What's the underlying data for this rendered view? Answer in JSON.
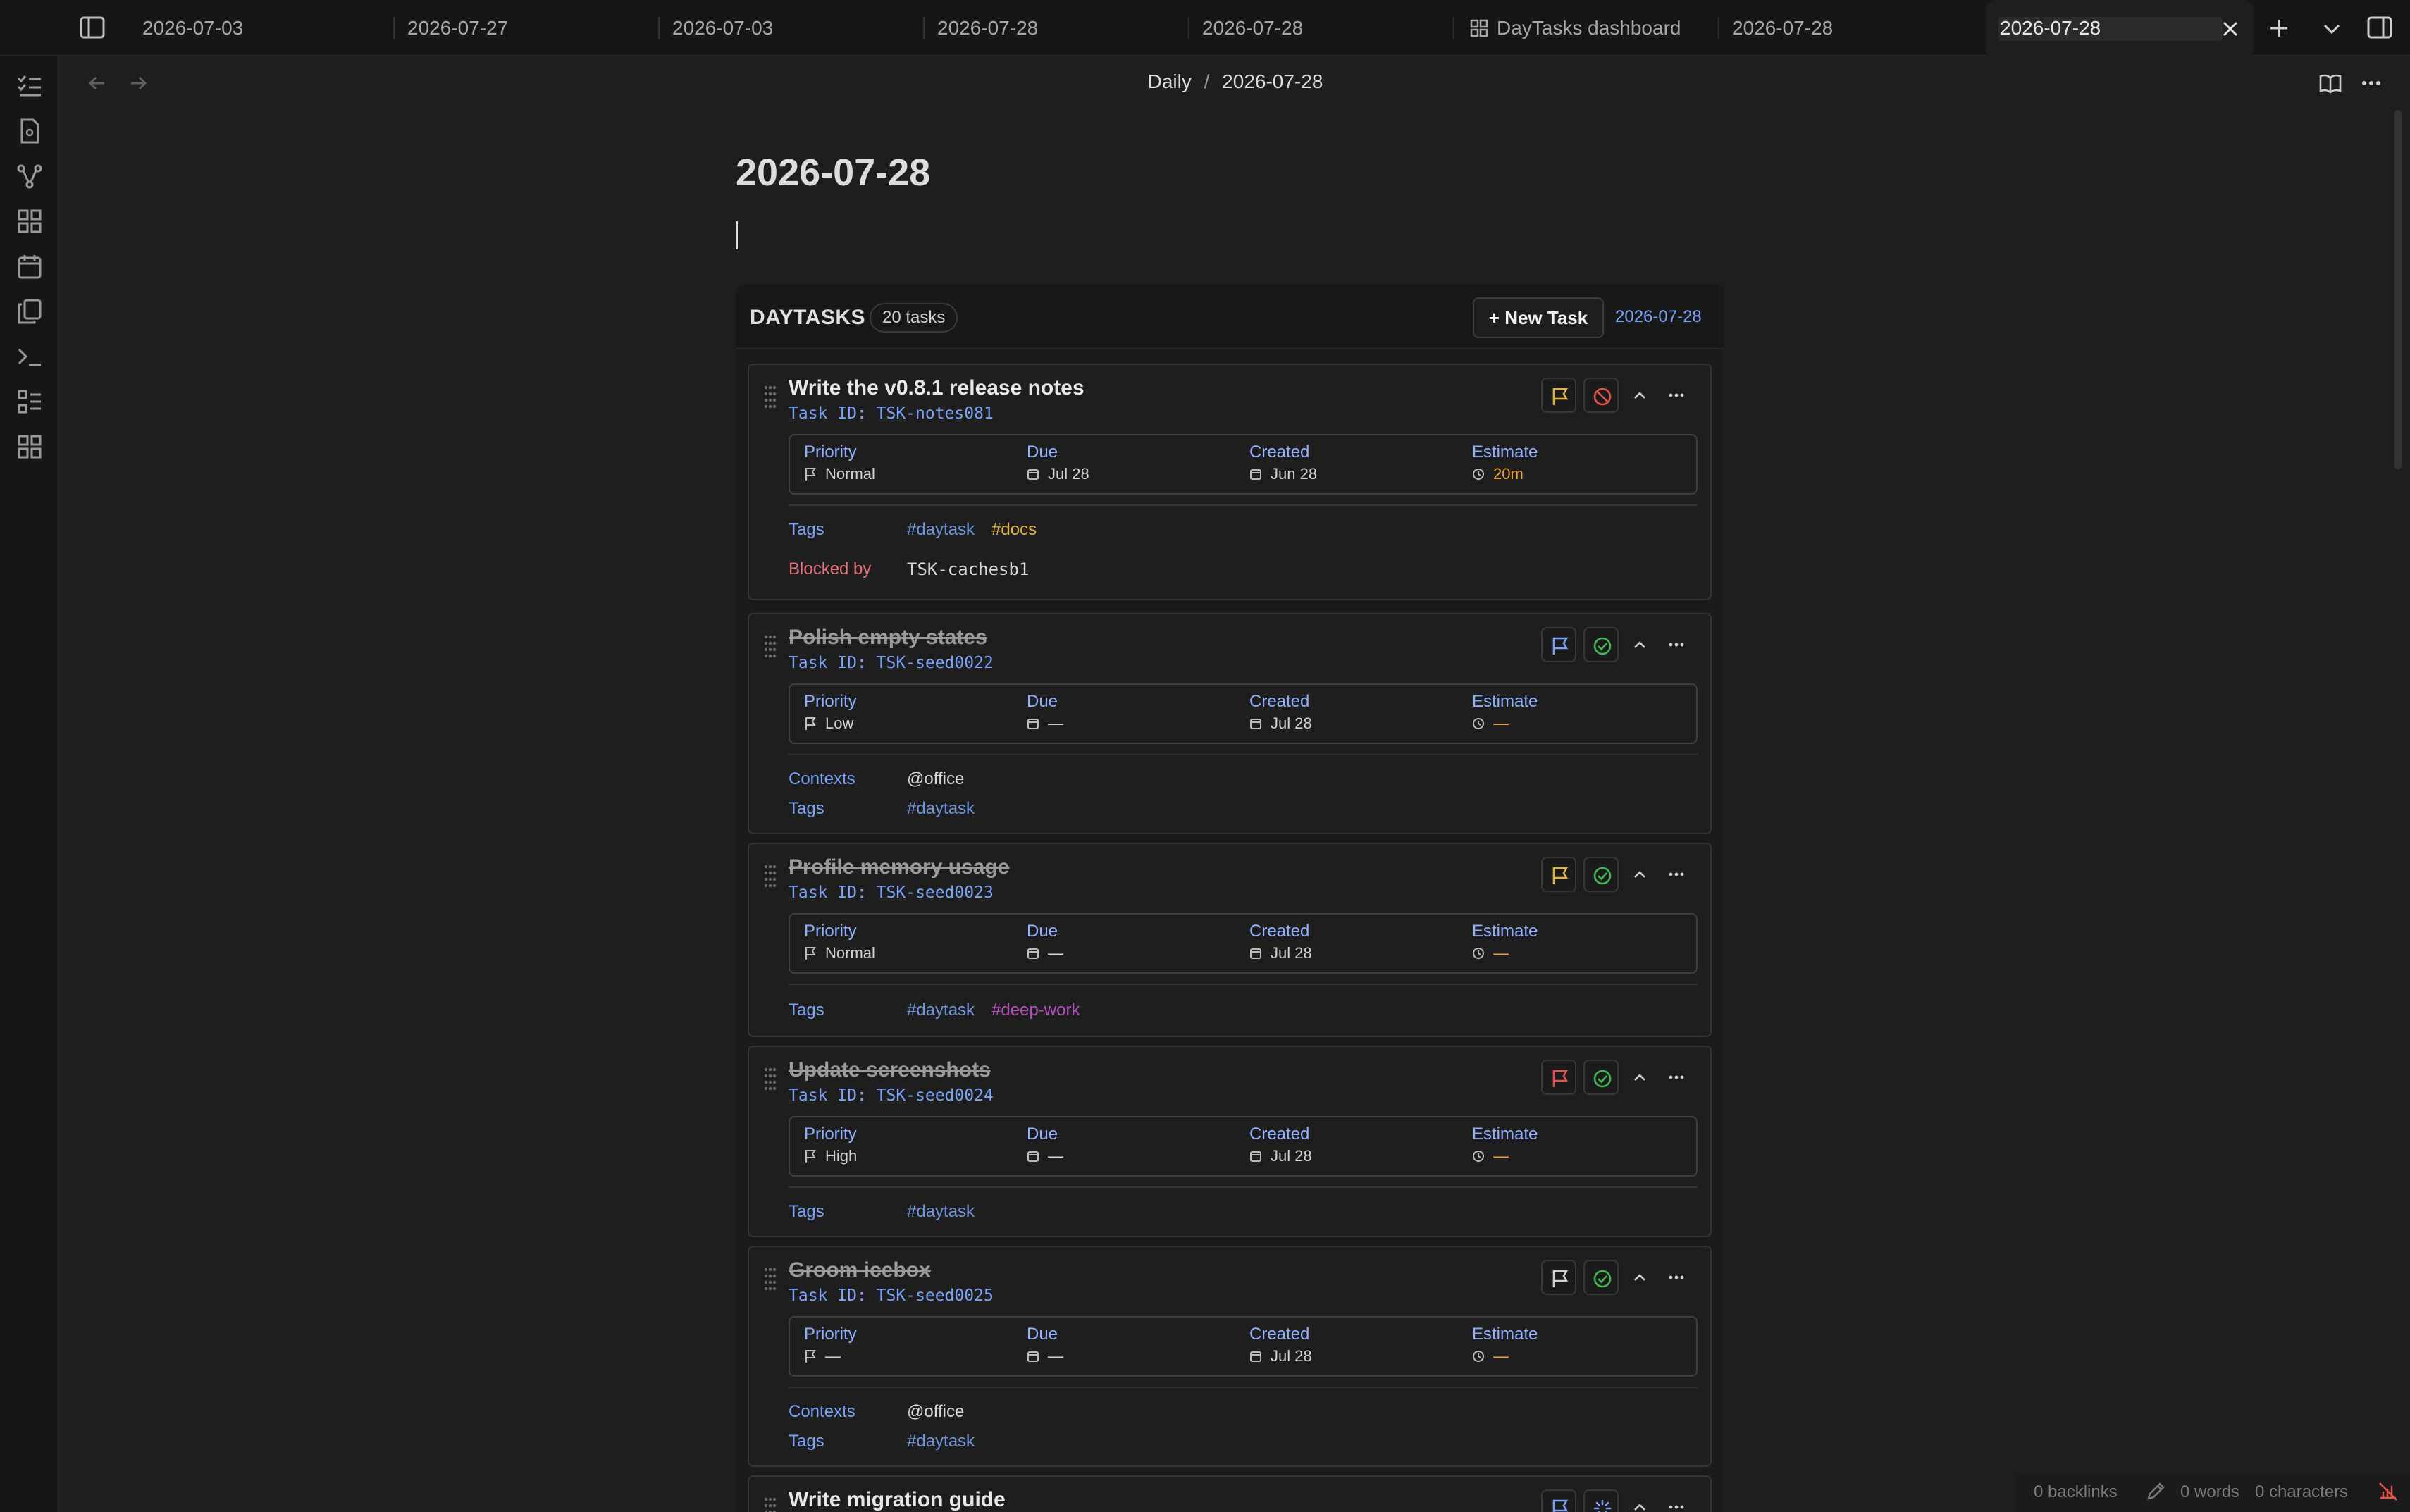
{
  "tabs": [
    {
      "label": "2026-07-03"
    },
    {
      "label": "2026-07-27"
    },
    {
      "label": "2026-07-03"
    },
    {
      "label": "2026-07-28"
    },
    {
      "label": "2026-07-28"
    },
    {
      "label": "DayTasks dashboard"
    },
    {
      "label": "2026-07-28"
    },
    {
      "label": "2026-07-28"
    }
  ],
  "breadcrumb": {
    "folder": "Daily",
    "sep": "/",
    "note": "2026-07-28"
  },
  "note": {
    "title": "2026-07-28"
  },
  "daytasks": {
    "title": "DAYTASKS",
    "count": "20 tasks",
    "new_task_label": "+ New Task",
    "date": "2026-07-28",
    "labels": {
      "priority": "Priority",
      "due": "Due",
      "created": "Created",
      "estimate": "Estimate",
      "tags": "Tags",
      "contexts": "Contexts",
      "blocked_by": "Blocked by"
    },
    "tasks": [
      {
        "title": "Write the v0.8.1 release notes",
        "id": "Task ID: TSK-notes081",
        "priority": "Normal",
        "due": "Jul 28",
        "created": "Jun 28",
        "estimate": "20m",
        "tags": [
          "#daytask",
          "#docs"
        ],
        "blocked_by": "TSK-cachesb1",
        "flag_color": "#e2b340",
        "status": "blocked"
      },
      {
        "title": "Polish empty states",
        "id": "Task ID: TSK-seed0022",
        "priority": "Low",
        "due": "—",
        "created": "Jul 28",
        "estimate": "—",
        "contexts": "@office",
        "tags": [
          "#daytask"
        ],
        "flag_color": "#7aa2f7",
        "status": "done"
      },
      {
        "title": "Profile memory usage",
        "id": "Task ID: TSK-seed0023",
        "priority": "Normal",
        "due": "—",
        "created": "Jul 28",
        "estimate": "—",
        "tags": [
          "#daytask",
          "#deep-work"
        ],
        "flag_color": "#e2b340",
        "status": "done"
      },
      {
        "title": "Update screenshots",
        "id": "Task ID: TSK-seed0024",
        "priority": "High",
        "due": "—",
        "created": "Jul 28",
        "estimate": "—",
        "tags": [
          "#daytask"
        ],
        "flag_color": "#e5534b",
        "status": "done"
      },
      {
        "title": "Groom icebox",
        "id": "Task ID: TSK-seed0025",
        "priority": "—",
        "due": "—",
        "created": "Jul 28",
        "estimate": "—",
        "contexts": "@office",
        "tags": [
          "#daytask"
        ],
        "flag_color": "#cfcfcf",
        "status": "done"
      },
      {
        "title": "Write migration guide",
        "flag_color": "#7aa2f7",
        "status": "in-progress"
      }
    ]
  },
  "statusbar": {
    "backlinks": "0 backlinks",
    "words": "0 words",
    "characters": "0 characters"
  },
  "colors": {
    "accent": "#7aa2f7",
    "done": "#3fb950",
    "blocked": "#e5534b",
    "estimate": "#f0a030"
  }
}
